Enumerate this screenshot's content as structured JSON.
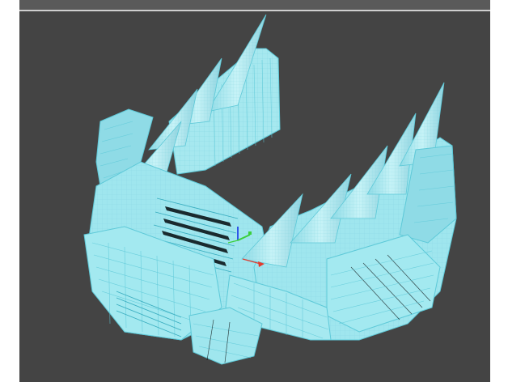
{
  "app": {
    "window": "3D viewport",
    "viewport_background": "#444444"
  },
  "model": {
    "wire_color": "#5ec9d8",
    "surface_color": "#9fe6ee",
    "shade_color": "#7fcfdb",
    "dark_slot_color": "#1a2a2e"
  },
  "gizmo": {
    "x_axis_color": "#e23b2e",
    "y_axis_color": "#3ccf3c",
    "z_axis_color": "#2f55e8"
  }
}
